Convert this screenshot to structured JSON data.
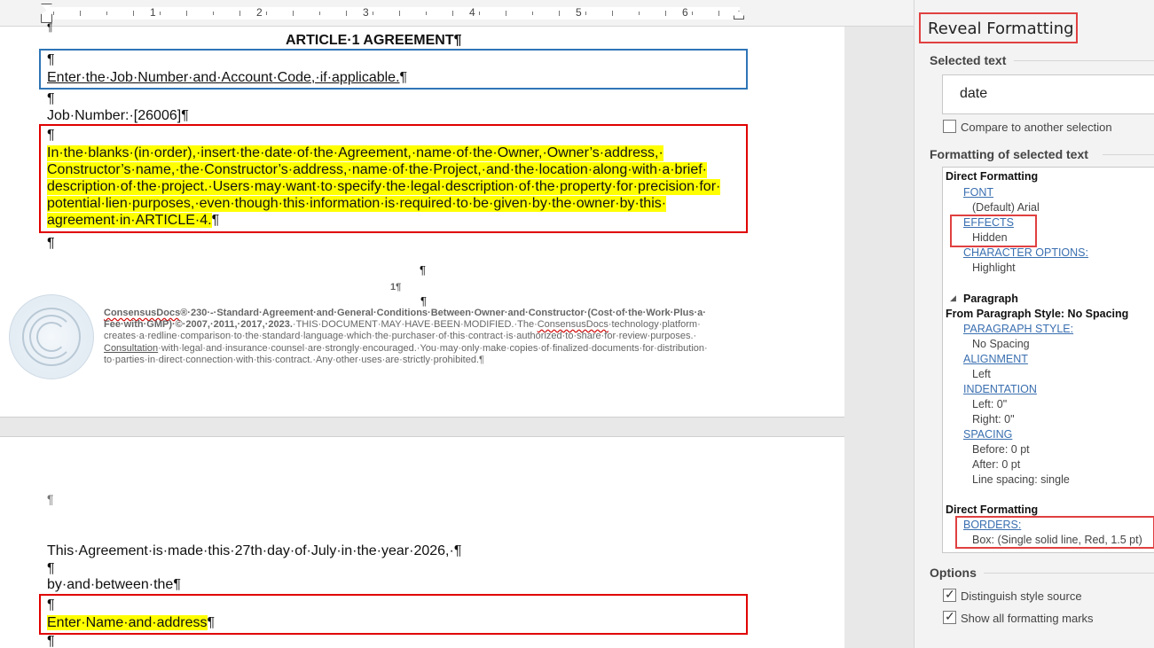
{
  "ruler": {
    "numbers": [
      "1",
      "2",
      "3",
      "4",
      "5",
      "6"
    ]
  },
  "page1": {
    "title": "ARTICLE·1 AGREEMENT¶",
    "pilcrow": "¶",
    "job_hint": "Enter·the·Job·Number·and·Account·Code,·if·applicable.",
    "job_number": "Job·Number:·[26006]¶",
    "instruction_lines": [
      "In·the·blanks·(in·order),·insert·the·date·of·the·Agreement,·name·of·the·Owner,·Owner’s·address,·",
      "Constructor’s·name,·the·Constructor’s·address,·name·of·the·Project,·and·the·location·along·with·a·brief·",
      "description·of·the·project.·Users·may·want·to·specify·the·legal·description·of·the·property·for·precision·for·",
      "potential·lien·purposes,·even·though·this·information·is·required·to·be·given·by·the·owner·by·this·",
      "agreement·in·ARTICLE·4."
    ],
    "page_number": "1¶",
    "footer": {
      "brand": "ConsensusDocs",
      "line1_rest": "®·230·-·Standard·Agreement·and·General·Conditions·Between·Owner·and·Constructor·(Cost·of·the·Work·Plus·a·",
      "line2_bold": "Fee·with·GMP)·©·2007,·2011,·2017,·2023.",
      "line2_normal": "·THIS·DOCUMENT·MAY·HAVE·BEEN·MODIFIED.·The·",
      "line2_tail": "·technology·platform·",
      "line3": "creates·a·redline·comparison·to·the·standard·language·which·the·purchaser·of·this·contract·is·authorized·to·share·for·review·purposes.·",
      "line4_link": "Consultation",
      "line4_rest": "·with·legal·and·insurance·counsel·are·strongly·encouraged.·You·may·only·make·copies·of·finalized·documents·for·distribution·",
      "line5": "to·parties·in·direct·connection·with·this·contract.·Any·other·uses·are·strictly·prohibited.¶"
    }
  },
  "page2": {
    "agreement_line": "This·Agreement·is·made·this·27th·day·of·July·in·the·year·2026,·¶",
    "between_line": "by·and·between·the¶",
    "name_address": "Enter·Name·and·address"
  },
  "pane": {
    "title": "Reveal Formatting",
    "selected_text_heading": "Selected text",
    "selected_text_value": "date",
    "compare_label": "Compare to another selection",
    "formatting_heading": "Formatting of selected text",
    "direct_formatting_1": "Direct Formatting",
    "font_link": "FONT",
    "font_value": "(Default) Arial",
    "effects_link": "EFFECTS",
    "effects_value": "Hidden",
    "char_options_link": "CHARACTER OPTIONS:",
    "char_options_value": "Highlight",
    "paragraph_section": "Paragraph",
    "from_style": "From Paragraph Style: No Spacing",
    "para_style_link": "PARAGRAPH STYLE:",
    "para_style_value": "No Spacing",
    "alignment_link": "ALIGNMENT",
    "alignment_value": "Left",
    "indentation_link": "INDENTATION",
    "indent_left": "Left:  0\"",
    "indent_right": "Right:  0\"",
    "spacing_link": "SPACING",
    "spacing_before": "Before:  0 pt",
    "spacing_after": "After:  0 pt",
    "line_spacing": "Line spacing:  single",
    "direct_formatting_2": "Direct Formatting",
    "borders_link": "BORDERS:",
    "borders_value": "Box: (Single solid line, Red,  1.5 pt)",
    "options_heading": "Options",
    "distinguish_label": "Distinguish style source",
    "show_marks_label": "Show all formatting marks"
  },
  "colors": {
    "highlight": "#ffff00",
    "border_red": "#e00000",
    "border_blue": "#2e75b6",
    "link_blue": "#3a6fb0",
    "annotation_red": "#e04040"
  }
}
